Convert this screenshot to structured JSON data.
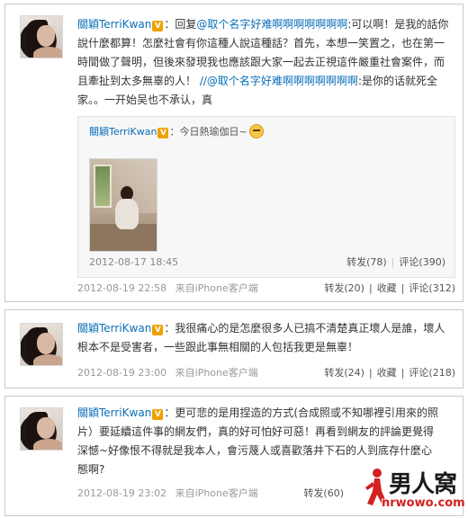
{
  "posts": [
    {
      "username": "關穎TerriKwan",
      "verified_badge": "V",
      "body_prefix": "：回复",
      "mention1": "@取个名字好难啊啊啊啊啊啊啊",
      "body_main": ":可以啊！是我的話你說什麼都算！怎麼社會有你這種人說這種話？首先，本想一笑置之，也在第一時間做了聲明，但後來發現我也應該跟大家一起去正視這件嚴重社會案件，而且牽扯到太多無辜的人！",
      "mention2": "//@取个名字好难啊啊啊啊啊啊啊",
      "body_tail": ":是你的话就死全家。。一开始吴也不承认，真",
      "quote": {
        "username": "關穎TerriKwan",
        "verified_badge": "V",
        "text": "：今日熱瑜伽日~",
        "emoji": "smiley-icon",
        "time": "2012-08-17 18:45",
        "repost": "转发(78)",
        "comment": "评论(390)"
      },
      "time": "2012-08-19 22:58",
      "source": "来自iPhone客户端",
      "repost": "转发(20)",
      "favorite": "收藏",
      "comment": "评论(312)"
    },
    {
      "username": "關穎TerriKwan",
      "verified_badge": "V",
      "body": "：我很痛心的是怎麼很多人已搞不清楚真正壞人是誰，壞人根本不是受害者，一些跟此事無相關的人包括我更是無辜！",
      "time": "2012-08-19 23:00",
      "source": "来自iPhone客户端",
      "repost": "转发(24)",
      "favorite": "收藏",
      "comment": "评论(218)"
    },
    {
      "username": "關穎TerriKwan",
      "verified_badge": "V",
      "body": "：更可悲的是用捏造的方式(合成照或不知哪裡引用來的照片）要延續這件事的網友們，真的好可怕好可惡！再看到網友的評論更覺得深憾~好像恨不得就是我本人，會污蔑人或喜歡落井下石的人到底存什麼心態啊?",
      "time": "2012-08-19 23:02",
      "source": "来自iPhone客户端",
      "repost": "转发(60)"
    }
  ],
  "watermark": {
    "brand": "男人窝",
    "url": "nrwowo.com",
    "colors": {
      "brand": "#1a1a1a",
      "url": "#d32020",
      "mark": "#d32020"
    }
  },
  "colors": {
    "link": "#0a6fb8",
    "badge": "#f0a000",
    "meta": "#999999",
    "border": "#c9c9c9"
  }
}
